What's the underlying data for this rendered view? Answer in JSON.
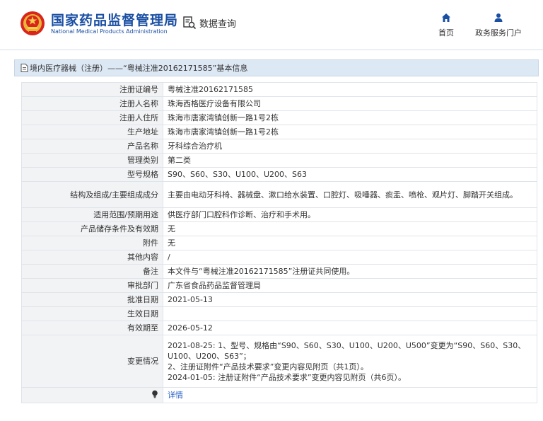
{
  "header": {
    "title": "国家药品监督管理局",
    "subtitle": "National Medical Products Administration",
    "query_label": "数据查询",
    "nav": [
      {
        "label": "首页",
        "icon": "home-icon"
      },
      {
        "label": "政务服务门户",
        "icon": "user-icon"
      }
    ]
  },
  "breadcrumb": "境内医疗器械（注册）——“粤械注准20162171585”基本信息",
  "rows": [
    {
      "key": "注册证编号",
      "value": "粤械注准20162171585"
    },
    {
      "key": "注册人名称",
      "value": "珠海西格医疗设备有限公司"
    },
    {
      "key": "注册人住所",
      "value": "珠海市唐家湾镇创新一路1号2栋"
    },
    {
      "key": "生产地址",
      "value": "珠海市唐家湾镇创新一路1号2栋"
    },
    {
      "key": "产品名称",
      "value": "牙科综合治疗机"
    },
    {
      "key": "管理类别",
      "value": "第二类"
    },
    {
      "key": "型号规格",
      "value": "S90、S60、S30、U100、U200、S63"
    },
    {
      "key": "结构及组成/主要组成成分",
      "value": "主要由电动牙科椅、器械盘、漱口给水装置、口腔灯、吸唾器、痰盂、喷枪、观片灯、脚踏开关组成。"
    },
    {
      "key": "适用范围/预期用途",
      "value": "供医疗部门口腔科作诊断、治疗和手术用。"
    },
    {
      "key": "产品储存条件及有效期",
      "value": "无"
    },
    {
      "key": "附件",
      "value": "无"
    },
    {
      "key": "其他内容",
      "value": "/"
    },
    {
      "key": "备注",
      "value": "本文件与“粤械注准20162171585”注册证共同使用。"
    },
    {
      "key": "审批部门",
      "value": "广东省食品药品监督管理局"
    },
    {
      "key": "批准日期",
      "value": "2021-05-13"
    },
    {
      "key": "生效日期",
      "value": ""
    },
    {
      "key": "有效期至",
      "value": "2026-05-12"
    }
  ],
  "changes": {
    "key": "变更情况",
    "lines": [
      "2021-08-25: 1、型号、规格由“S90、S60、S30、U100、U200、U500”变更为“S90、S60、S30、U100、U200、S63”；",
      "2、注册证附件“产品技术要求”变更内容见附页（共1页）。",
      "2024-01-05: 注册证附件“产品技术要求”变更内容见附页（共6页）。"
    ]
  },
  "detail": {
    "icon": "bulb-icon",
    "link_label": "详情"
  },
  "colors": {
    "brand_blue": "#1a4fa3",
    "header_bg": "#dde8f5",
    "key_bg": "#f2f3f5",
    "link": "#2a63c7"
  }
}
